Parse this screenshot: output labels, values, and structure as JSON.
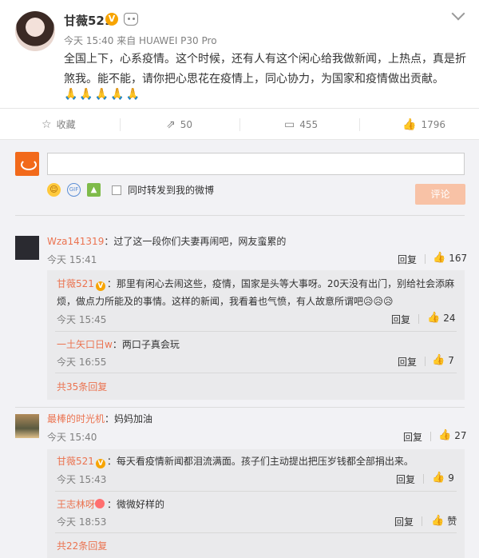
{
  "post": {
    "author": "甘薇521",
    "meta": "今天 15:40 来自 HUAWEI P30 Pro",
    "text": "全国上下，心系疫情。这个时候，还有人有这个闲心给我做新闻，上热点，真是折煞我。能不能，请你把心思花在疫情上，同心协力，为国家和疫情做出贡献。",
    "emojis": "🙏🙏🙏🙏🙏"
  },
  "actions": {
    "favorite_label": "收藏",
    "repost_count": "50",
    "comment_count": "455",
    "like_count": "1796"
  },
  "composer": {
    "sync_label": "同时转发到我的微博",
    "submit_label": "评论",
    "icon_gif": "GIF"
  },
  "comments": [
    {
      "name": "Wza141319",
      "text": "：过了这一段你们夫妻再闹吧，网友蛮累的",
      "time": "今天 15:41",
      "reply": "回复",
      "likes": "167",
      "subs": [
        {
          "name": "甘薇521",
          "text": "：那里有闲心去闹这些，疫情，国家是头等大事呀。20天没有出门，别给社会添麻烦，做点力所能及的事情。这样的新闻，我看着也气愤，有人故意所谓吧",
          "emojis": "😥😥😥",
          "time": "今天 15:45",
          "reply": "回复",
          "likes": "24"
        },
        {
          "name": "一土矢口日w",
          "text": "：两口子真会玩",
          "time": "今天 16:55",
          "reply": "回复",
          "likes": "7"
        }
      ],
      "more": "共35条回复"
    },
    {
      "name": "最棒的时光机",
      "text": "：妈妈加油",
      "time": "今天 15:40",
      "reply": "回复",
      "likes": "27",
      "subs": [
        {
          "name": "甘薇521",
          "text": "：每天看疫情新闻都泪流满面。孩子们主动提出把压岁钱都全部捐出来。",
          "time": "今天 15:43",
          "reply": "回复",
          "likes": "9"
        },
        {
          "name": "王志林呀",
          "text": "：微微好样的",
          "time": "今天 18:53",
          "reply": "回复",
          "likes": "赞"
        }
      ],
      "more": "共22条回复"
    }
  ]
}
